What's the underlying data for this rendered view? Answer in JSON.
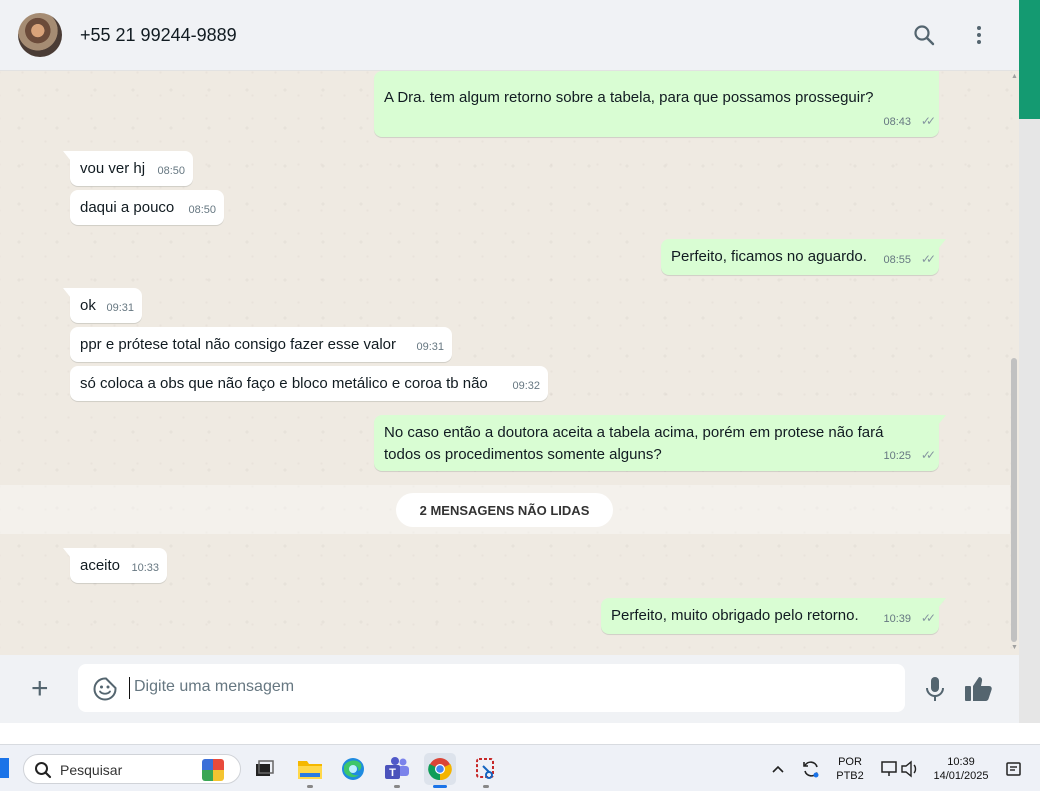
{
  "header": {
    "contact_name": "+55 21 99244-9889"
  },
  "messages": [
    {
      "dir": "out",
      "text": "A Dra. tem algum retorno sobre a tabela, para que possamos prosseguir?",
      "time": "08:43"
    },
    {
      "dir": "in",
      "text": "vou ver hj",
      "time": "08:50"
    },
    {
      "dir": "in",
      "text": "daqui a pouco",
      "time": "08:50"
    },
    {
      "dir": "out",
      "text": "Perfeito, ficamos no aguardo.",
      "time": "08:55"
    },
    {
      "dir": "in",
      "text": "ok",
      "time": "09:31"
    },
    {
      "dir": "in",
      "text": "ppr e prótese total não consigo fazer esse valor",
      "time": "09:31"
    },
    {
      "dir": "in",
      "text": "só coloca a obs que não faço e bloco metálico e coroa tb não",
      "time": "09:32"
    },
    {
      "dir": "out",
      "text": "No caso então a doutora aceita a tabela acima, porém em protese não fará todos os procedimentos somente alguns?",
      "time": "10:25"
    },
    {
      "dir": "in",
      "text": "aceito",
      "time": "10:33"
    },
    {
      "dir": "out",
      "text": "Perfeito, muito obrigado pelo retorno.",
      "time": "10:39"
    }
  ],
  "unread_banner": "2 MENSAGENS NÃO LIDAS",
  "composer": {
    "placeholder": "Digite uma mensagem"
  },
  "taskbar": {
    "search_placeholder": "Pesquisar",
    "lang_line1": "POR",
    "lang_line2": "PTB2",
    "clock_time": "10:39",
    "clock_date": "14/01/2025"
  },
  "colors": {
    "outgoing_bubble": "#d9fdd3",
    "incoming_bubble": "#ffffff",
    "chat_background": "#efeae2",
    "accent_green": "#149a71"
  }
}
